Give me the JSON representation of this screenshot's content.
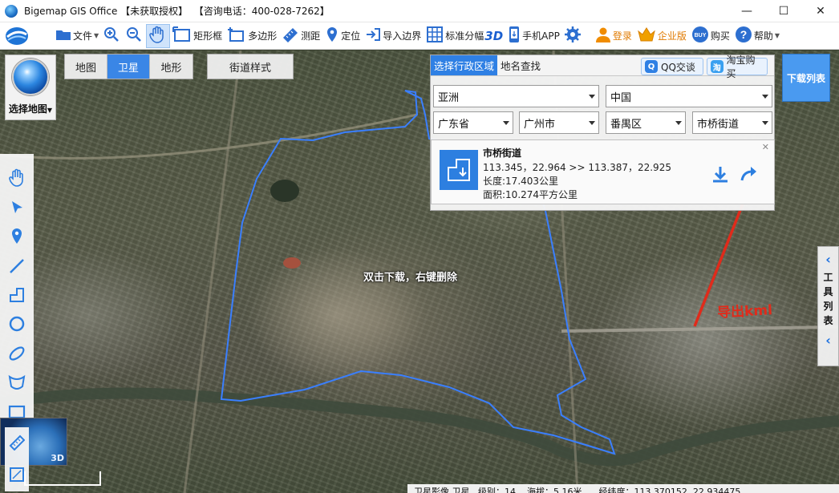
{
  "window": {
    "title": "Bigemap GIS Office 【未获取授权】  【咨询电话：400-028-7262】",
    "minimize": "—",
    "maximize": "☐",
    "close": "✕"
  },
  "toolbar": {
    "items": [
      {
        "label": "文件",
        "icon": "folder-icon"
      },
      {
        "label": "",
        "icon": "zoom-in-icon"
      },
      {
        "label": "",
        "icon": "zoom-out-icon"
      },
      {
        "label": "",
        "icon": "hand-pan-icon"
      },
      {
        "label": "矩形框",
        "icon": "rectangle-select-icon"
      },
      {
        "label": "多边形",
        "icon": "polygon-select-icon"
      },
      {
        "label": "测距",
        "icon": "ruler-icon"
      },
      {
        "label": "定位",
        "icon": "location-pin-icon"
      },
      {
        "label": "导入边界",
        "icon": "import-boundary-icon"
      },
      {
        "label": "标准分幅",
        "icon": "grid-icon",
        "suffix": "3D"
      },
      {
        "label": "手机APP",
        "icon": "phone-icon"
      },
      {
        "label": "",
        "icon": "gear-icon"
      },
      {
        "label": "登录",
        "icon": "user-icon"
      },
      {
        "label": "企业版",
        "icon": "crown-icon"
      },
      {
        "label": "购买",
        "icon": "buy-icon"
      },
      {
        "label": "帮助",
        "icon": "help-icon"
      }
    ]
  },
  "map_controls": {
    "select_map_label": "选择地图",
    "tabs": [
      {
        "label": "地图",
        "active": false
      },
      {
        "label": "卫星",
        "active": true
      },
      {
        "label": "地形",
        "active": false
      }
    ],
    "street_style": "街道样式",
    "minimap_label": "3D"
  },
  "region_panel": {
    "tabs": [
      {
        "label": "选择行政区域",
        "active": true
      },
      {
        "label": "地名查找",
        "active": false
      }
    ],
    "qq_button": "QQ交谈",
    "taobao_button": "淘宝购买",
    "selects": {
      "continent": "亚洲",
      "country": "中国",
      "province": "广东省",
      "city": "广州市",
      "district": "番禺区",
      "street": "市桥街道"
    },
    "result": {
      "name": "市桥街道",
      "coords": "113.345，22.964 >> 113.387，22.925",
      "length": "长度:17.403公里",
      "area": "面积:10.274平方公里"
    }
  },
  "download_list_button": "下载列表",
  "tool_list_tab": "工具列表",
  "map_hint": "双击下载，右键删除",
  "annotation_label": "导出kml",
  "status_bar": "卫星影像 卫星   级别：14    海拔：5.16米      经纬度：113.370152, 22.934475",
  "colors": {
    "accent": "#2f80e4",
    "boundary": "#3a7fff",
    "annotation": "#e02b1b"
  }
}
